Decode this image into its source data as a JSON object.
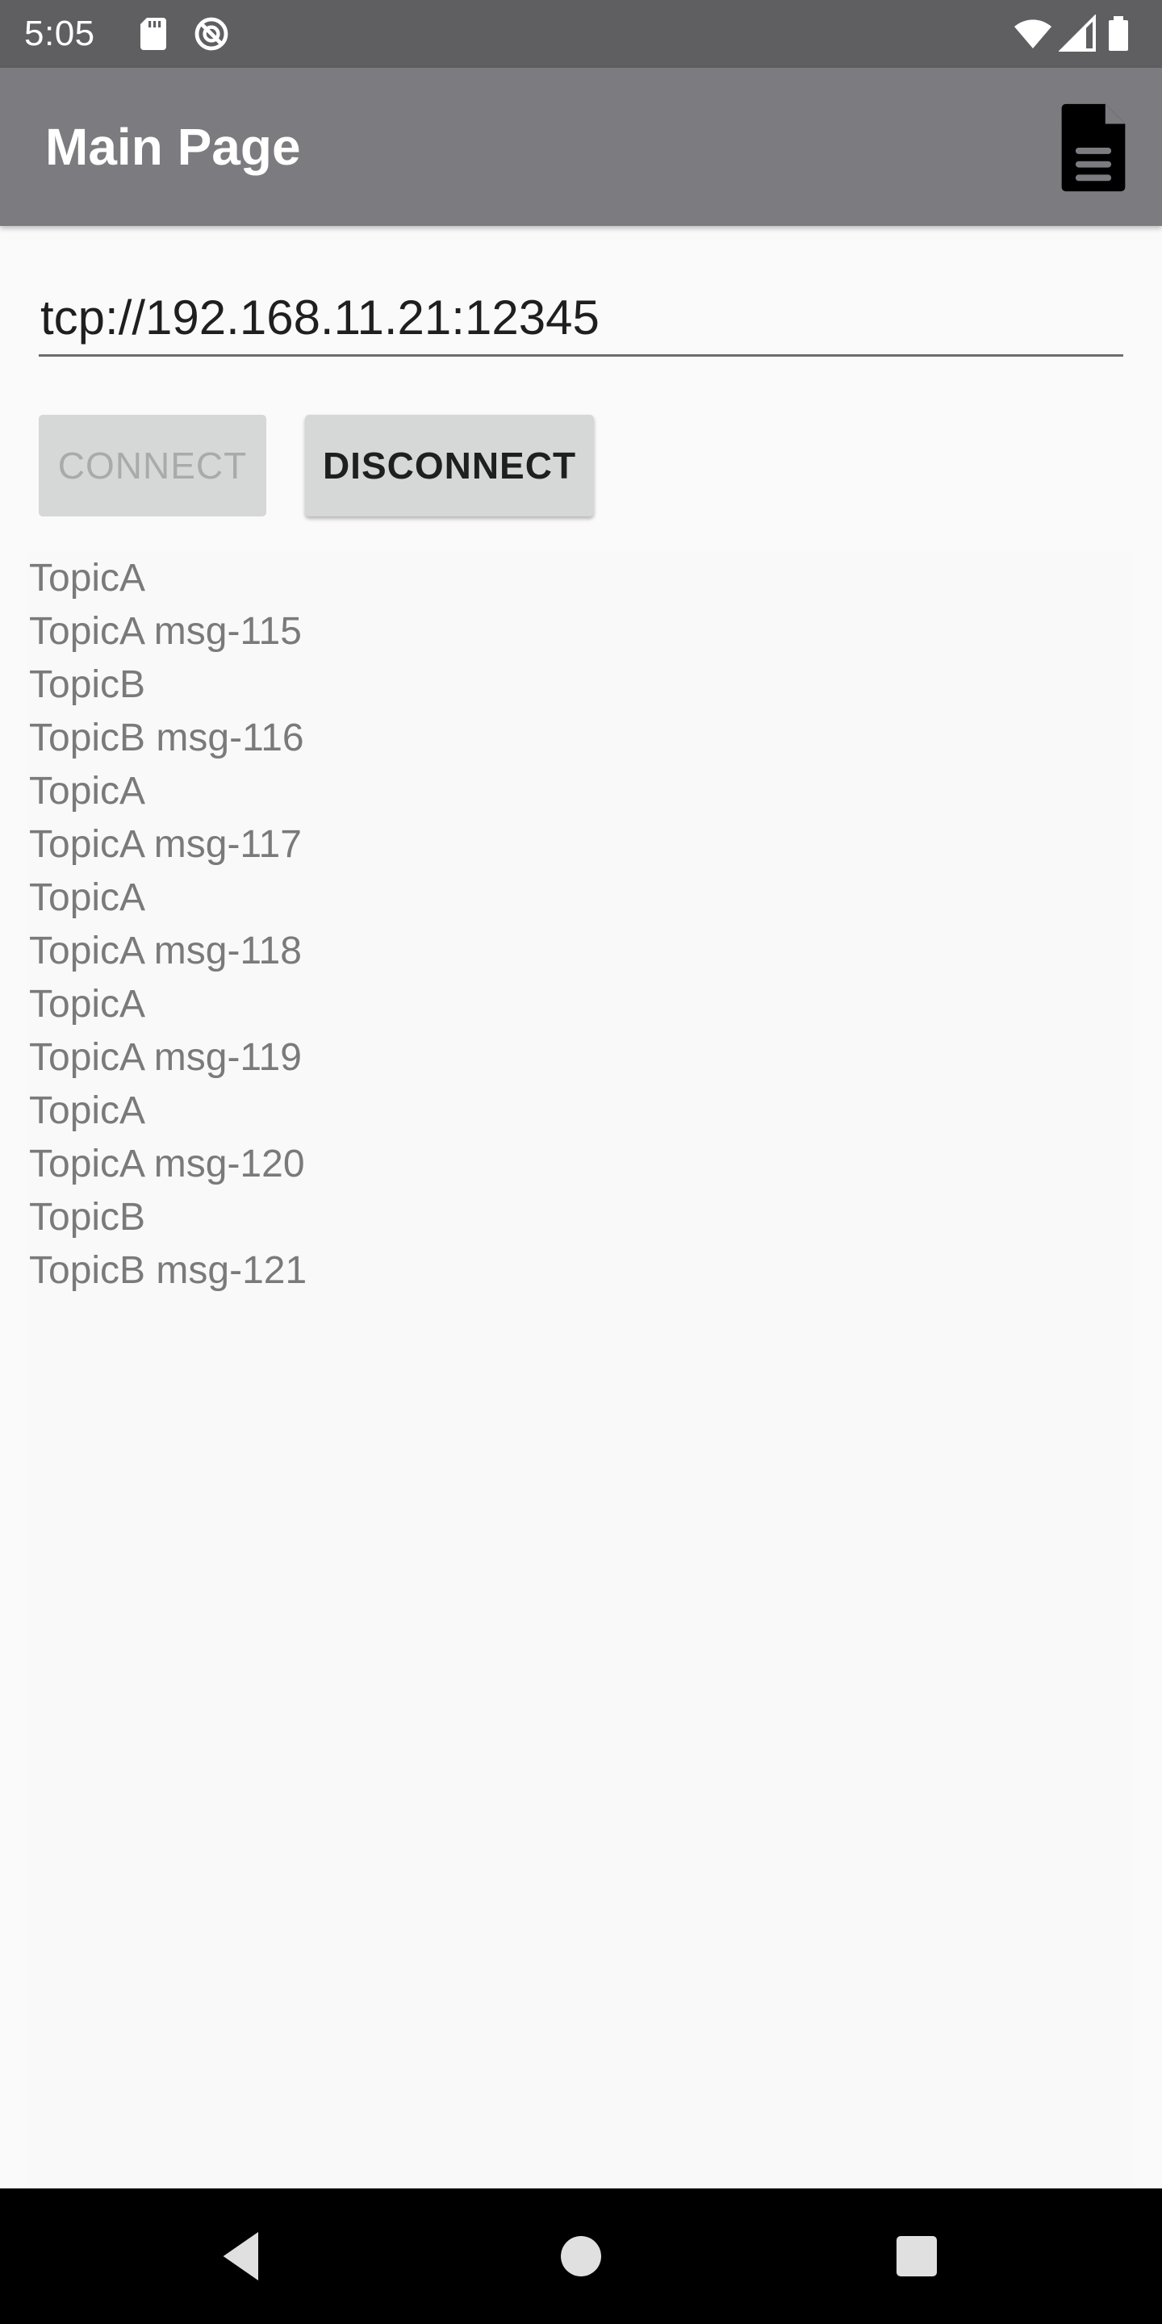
{
  "status_bar": {
    "time": "5:05",
    "left_icons": [
      "sd-card-icon",
      "no-sync-icon"
    ],
    "right_icons": [
      "wifi-icon",
      "signal-icon",
      "battery-icon"
    ]
  },
  "app_bar": {
    "title": "Main Page",
    "action_icon": "document-icon"
  },
  "connection": {
    "url_value": "tcp://192.168.11.21:12345",
    "connect_label": "CONNECT",
    "connect_enabled": false,
    "disconnect_label": "DISCONNECT",
    "disconnect_enabled": true
  },
  "messages": [
    "TopicA",
    "TopicA msg-115",
    "TopicB",
    "TopicB msg-116",
    "TopicA",
    "TopicA msg-117",
    "TopicA",
    "TopicA msg-118",
    "TopicA",
    "TopicA msg-119",
    "TopicA",
    "TopicA msg-120",
    "TopicB",
    "TopicB msg-121"
  ],
  "nav_bar": {
    "buttons": [
      "back-icon",
      "home-icon",
      "recents-icon"
    ]
  },
  "colors": {
    "status_bar": "#5f5f62",
    "app_bar": "#7b7b80",
    "button_bg": "#d6d7d7",
    "message_text": "#7a7a7a"
  }
}
